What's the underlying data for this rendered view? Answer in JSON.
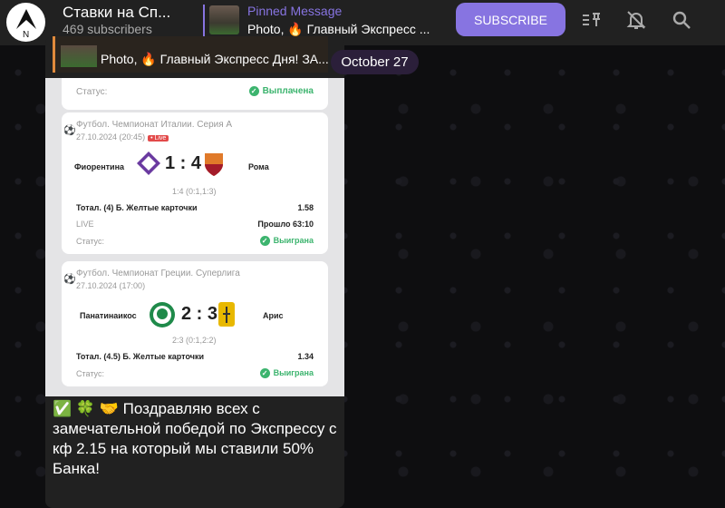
{
  "header": {
    "title": "Ставки на Сп...",
    "subscribers": "469 subscribers",
    "pinned_title": "Pinned Message",
    "pinned_text": "Photo, 🔥 Главный Экспресс ...",
    "subscribe_label": "SUBSCRIBE",
    "icons": [
      "pinned-list-icon",
      "bell-off-icon",
      "search-icon"
    ]
  },
  "date_pill": "October 27",
  "message": {
    "reply_text": "Photo, 🔥 Главный Экспресс Дня! ЗА...",
    "photo": {
      "top_status_label": "Статус:",
      "top_status_value": "Выплачена",
      "matches": [
        {
          "league": "Футбол. Чемпионат Италии. Серия А",
          "datetime": "27.10.2024 (20:45)",
          "live_badge": "• Live",
          "home": "Фиорентина",
          "score": "1 : 4",
          "away": "Рома",
          "detail": "1:4 (0:1,1:3)",
          "bet": "Тотал. (4) Б. Желтые карточки",
          "odds": "1.58",
          "live_label": "LIVE",
          "elapsed": "Прошло 63:10",
          "status_label": "Статус:",
          "status_value": "Выиграна"
        },
        {
          "league": "Футбол. Чемпионат Греции. Суперлига",
          "datetime": "27.10.2024 (17:00)",
          "home": "Панатинаикос",
          "score": "2 : 3",
          "away": "Арис",
          "detail": "2:3 (0:1,2:2)",
          "bet": "Тотал. (4.5) Б. Желтые карточки",
          "odds": "1.34",
          "status_label": "Статус:",
          "status_value": "Выиграна"
        }
      ]
    },
    "caption": "✅ 🍀 🤝 Поздравляю всех с замечательной победой по Экспрессу с кф 2.15 на который мы ставили 50% Банка!"
  },
  "colors": {
    "accent": "#8774e1",
    "win": "#3cb46e",
    "header_bg": "#212121"
  }
}
